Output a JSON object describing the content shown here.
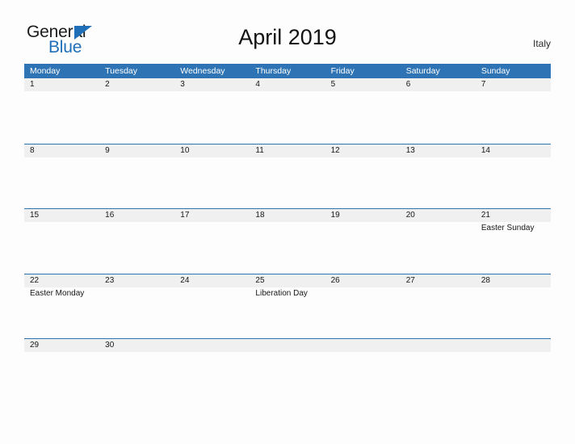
{
  "brand": {
    "word_one": "General",
    "word_two": "Blue",
    "logo_icon": "blue-triangle-flag-icon",
    "accent_color": "#1f6fb8"
  },
  "header": {
    "title": "April 2019",
    "country": "Italy"
  },
  "theme": {
    "header_blue": "#2e74b5",
    "date_band_gray": "#f0f0f0",
    "page_background": "#fdfdfd",
    "text_color": "#171717"
  },
  "calendar": {
    "weekdays": [
      "Monday",
      "Tuesday",
      "Wednesday",
      "Thursday",
      "Friday",
      "Saturday",
      "Sunday"
    ],
    "weeks": [
      {
        "days": [
          {
            "num": "1",
            "note": ""
          },
          {
            "num": "2",
            "note": ""
          },
          {
            "num": "3",
            "note": ""
          },
          {
            "num": "4",
            "note": ""
          },
          {
            "num": "5",
            "note": ""
          },
          {
            "num": "6",
            "note": ""
          },
          {
            "num": "7",
            "note": ""
          }
        ]
      },
      {
        "days": [
          {
            "num": "8",
            "note": ""
          },
          {
            "num": "9",
            "note": ""
          },
          {
            "num": "10",
            "note": ""
          },
          {
            "num": "11",
            "note": ""
          },
          {
            "num": "12",
            "note": ""
          },
          {
            "num": "13",
            "note": ""
          },
          {
            "num": "14",
            "note": ""
          }
        ]
      },
      {
        "days": [
          {
            "num": "15",
            "note": ""
          },
          {
            "num": "16",
            "note": ""
          },
          {
            "num": "17",
            "note": ""
          },
          {
            "num": "18",
            "note": ""
          },
          {
            "num": "19",
            "note": ""
          },
          {
            "num": "20",
            "note": ""
          },
          {
            "num": "21",
            "note": "Easter Sunday"
          }
        ]
      },
      {
        "days": [
          {
            "num": "22",
            "note": "Easter Monday"
          },
          {
            "num": "23",
            "note": ""
          },
          {
            "num": "24",
            "note": ""
          },
          {
            "num": "25",
            "note": "Liberation Day"
          },
          {
            "num": "26",
            "note": ""
          },
          {
            "num": "27",
            "note": ""
          },
          {
            "num": "28",
            "note": ""
          }
        ]
      },
      {
        "days": [
          {
            "num": "29",
            "note": ""
          },
          {
            "num": "30",
            "note": ""
          },
          {
            "num": "",
            "note": ""
          },
          {
            "num": "",
            "note": ""
          },
          {
            "num": "",
            "note": ""
          },
          {
            "num": "",
            "note": ""
          },
          {
            "num": "",
            "note": ""
          }
        ]
      }
    ]
  }
}
